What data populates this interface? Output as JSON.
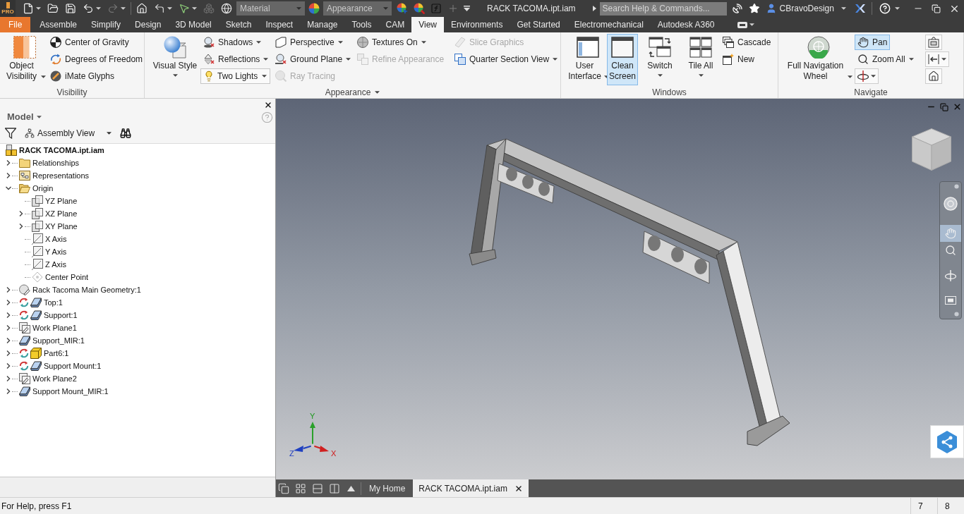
{
  "title_bar": {
    "edition": "PRO",
    "quick_access": [
      {
        "dropdown": true,
        "disabled": false
      },
      {
        "dropdown": false,
        "disabled": false
      },
      {
        "dropdown": false,
        "disabled": false
      },
      {
        "dropdown": true,
        "disabled": false
      },
      {
        "dropdown": true,
        "disabled": true
      },
      {
        "dropdown": false,
        "disabled": false
      },
      {
        "dropdown": true,
        "disabled": false
      },
      {
        "dropdown": true,
        "disabled": false
      },
      {
        "dropdown": false,
        "disabled": true
      },
      {
        "dropdown": false,
        "disabled": false
      }
    ],
    "material": {
      "value": "Material",
      "disabled": true
    },
    "appearance": {
      "value": "Appearance",
      "disabled": true
    },
    "appearance_tools": [
      {
        "disabled": false
      },
      {
        "disabled": false
      },
      {
        "disabled": false
      },
      {
        "disabled": true
      }
    ],
    "document": "RACK TACOMA.ipt.iam",
    "search": {
      "placeholder": "Search Help & Commands..."
    },
    "user": "CBravoDesign"
  },
  "ribbon_tabs": [
    {
      "label": "File",
      "kind": "application",
      "selected": false
    },
    {
      "label": "Assemble",
      "kind": "tab",
      "selected": false
    },
    {
      "label": "Simplify",
      "kind": "tab",
      "selected": false
    },
    {
      "label": "Design",
      "kind": "tab",
      "selected": false
    },
    {
      "label": "3D Model",
      "kind": "tab",
      "selected": false
    },
    {
      "label": "Sketch",
      "kind": "tab",
      "selected": false
    },
    {
      "label": "Inspect",
      "kind": "tab",
      "selected": false
    },
    {
      "label": "Manage",
      "kind": "tab",
      "selected": false
    },
    {
      "label": "Tools",
      "kind": "tab",
      "selected": false
    },
    {
      "label": "CAM",
      "kind": "tab",
      "selected": false
    },
    {
      "label": "View",
      "kind": "tab",
      "selected": true
    },
    {
      "label": "Environments",
      "kind": "tab",
      "selected": false
    },
    {
      "label": "Get Started",
      "kind": "tab",
      "selected": false
    },
    {
      "label": "Electromechanical",
      "kind": "tab",
      "selected": false
    },
    {
      "label": "Autodesk A360",
      "kind": "tab",
      "selected": false
    }
  ],
  "ribbon": {
    "panels": [
      {
        "title": "Visibility",
        "menu": false,
        "columns": [
          {
            "kind": "large",
            "label": "Object Visibility",
            "dropdown": true,
            "active": false,
            "disabled": false
          },
          {
            "kind": "small",
            "items": [
              {
                "kind": "button",
                "label": "Center of Gravity",
                "dropdown": false,
                "active": false,
                "disabled": false
              },
              {
                "kind": "button",
                "label": "Degrees of Freedom",
                "dropdown": false,
                "active": false,
                "disabled": false
              },
              {
                "kind": "button",
                "label": "iMate Glyphs",
                "dropdown": false,
                "active": false,
                "disabled": false
              }
            ]
          }
        ]
      },
      {
        "title": "Appearance",
        "menu": true,
        "columns": [
          {
            "kind": "large",
            "label": "Visual Style",
            "dropdown": true,
            "active": false,
            "disabled": false
          },
          {
            "kind": "small",
            "items": [
              {
                "kind": "button",
                "label": "Shadows",
                "dropdown": true,
                "active": false,
                "disabled": false
              },
              {
                "kind": "button",
                "label": "Reflections",
                "dropdown": true,
                "active": false,
                "disabled": false
              },
              {
                "kind": "combo",
                "label": "Two Lights",
                "dropdown": true,
                "active": false,
                "disabled": false
              }
            ]
          },
          {
            "kind": "small",
            "items": [
              {
                "kind": "button",
                "label": "Perspective",
                "dropdown": true,
                "active": false,
                "disabled": false
              },
              {
                "kind": "button",
                "label": "Ground Plane",
                "dropdown": true,
                "active": false,
                "disabled": false
              },
              {
                "kind": "button",
                "label": "Ray Tracing",
                "dropdown": false,
                "active": false,
                "disabled": true
              }
            ]
          },
          {
            "kind": "small",
            "items": [
              {
                "kind": "button",
                "label": "Textures On",
                "dropdown": true,
                "active": false,
                "disabled": false
              },
              {
                "kind": "button",
                "label": "Refine Appearance",
                "dropdown": false,
                "active": false,
                "disabled": true
              }
            ]
          },
          {
            "kind": "small",
            "items": [
              {
                "kind": "button",
                "label": "Slice Graphics",
                "dropdown": false,
                "active": false,
                "disabled": true
              },
              {
                "kind": "button",
                "label": "Quarter Section View",
                "dropdown": true,
                "active": false,
                "disabled": false
              }
            ]
          }
        ]
      },
      {
        "title": "Windows",
        "menu": false,
        "columns": [
          {
            "kind": "large",
            "label": "User Interface",
            "dropdown": true,
            "active": false,
            "disabled": false
          },
          {
            "kind": "large",
            "label": "Clean Screen",
            "dropdown": false,
            "active": true,
            "disabled": false
          },
          {
            "kind": "large",
            "label": "Switch",
            "dropdown": true,
            "active": false,
            "disabled": false
          },
          {
            "kind": "large",
            "label": "Tile All",
            "dropdown": true,
            "active": false,
            "disabled": false
          },
          {
            "kind": "small",
            "items": [
              {
                "kind": "button",
                "label": "Cascade",
                "dropdown": false,
                "active": false,
                "disabled": false
              },
              {
                "kind": "button",
                "label": "New",
                "dropdown": false,
                "active": false,
                "disabled": false
              }
            ]
          }
        ]
      },
      {
        "title": "Navigate",
        "menu": false,
        "columns": [
          {
            "kind": "large",
            "label": "Full Navigation Wheel",
            "dropdown": true,
            "active": false,
            "disabled": false
          },
          {
            "kind": "small",
            "items": [
              {
                "kind": "button",
                "label": "Pan",
                "dropdown": false,
                "active": true,
                "disabled": false
              },
              {
                "kind": "button",
                "label": "Zoom All",
                "dropdown": true,
                "active": false,
                "disabled": false
              },
              {
                "kind": "icon",
                "dropdown": true,
                "active": false,
                "disabled": false
              }
            ]
          },
          {
            "kind": "small",
            "items": [
              {
                "kind": "icon",
                "dropdown": false,
                "active": false,
                "disabled": false
              },
              {
                "kind": "icon",
                "dropdown": true,
                "active": false,
                "disabled": false
              },
              {
                "kind": "icon",
                "dropdown": false,
                "active": false,
                "disabled": false
              }
            ]
          }
        ]
      }
    ]
  },
  "browser": {
    "title": "Model",
    "view": "Assembly View",
    "tree": {
      "label": "RACK TACOMA.ipt.iam",
      "kind": "assembly",
      "children": [
        {
          "label": "Relationships",
          "kind": "folder",
          "adaptive": false,
          "expanded": false
        },
        {
          "label": "Representations",
          "kind": "representations",
          "adaptive": false,
          "expanded": false
        },
        {
          "label": "Origin",
          "kind": "folder",
          "adaptive": false,
          "expanded": true,
          "children": [
            {
              "label": "YZ Plane",
              "kind": "plane"
            },
            {
              "label": "XZ Plane",
              "kind": "plane",
              "expanded": false
            },
            {
              "label": "XY Plane",
              "kind": "plane",
              "expanded": false
            },
            {
              "label": "X Axis",
              "kind": "axis"
            },
            {
              "label": "Y Axis",
              "kind": "axis"
            },
            {
              "label": "Z Axis",
              "kind": "axis"
            },
            {
              "label": "Center Point",
              "kind": "point"
            }
          ]
        },
        {
          "label": "Rack Tacoma Main Geometry:1",
          "kind": "derived_part",
          "adaptive": false,
          "expanded": false
        },
        {
          "label": "Top:1",
          "kind": "part",
          "adaptive": true,
          "expanded": false
        },
        {
          "label": "Support:1",
          "kind": "part",
          "adaptive": true,
          "expanded": false
        },
        {
          "label": "Work Plane1",
          "kind": "work_plane",
          "adaptive": false,
          "expanded": false
        },
        {
          "label": "Support_MIR:1",
          "kind": "part",
          "adaptive": false,
          "expanded": false
        },
        {
          "label": "Part6:1",
          "kind": "box",
          "adaptive": true,
          "expanded": false
        },
        {
          "label": "Support Mount:1",
          "kind": "part",
          "adaptive": true,
          "expanded": false
        },
        {
          "label": "Work Plane2",
          "kind": "work_plane",
          "adaptive": false,
          "expanded": false
        },
        {
          "label": "Support Mount_MIR:1",
          "kind": "part",
          "adaptive": false,
          "expanded": false
        }
      ]
    }
  },
  "viewport": {
    "nav_bar": [
      {
        "kind": "wheel",
        "selected": false
      },
      {
        "kind": "pan",
        "selected": true
      },
      {
        "kind": "zoom",
        "selected": false
      },
      {
        "kind": "orbit",
        "selected": false
      },
      {
        "kind": "look_at",
        "selected": false
      }
    ],
    "triad": {
      "x": "X",
      "y": "Y",
      "z": "Z"
    }
  },
  "document_tabs": [
    {
      "label": "My Home",
      "selected": false,
      "closable": false
    },
    {
      "label": "RACK TACOMA.ipt.iam",
      "selected": true,
      "closable": true
    }
  ],
  "status_bar": {
    "help": "For Help, press F1",
    "fields": [
      "7",
      "8"
    ]
  }
}
